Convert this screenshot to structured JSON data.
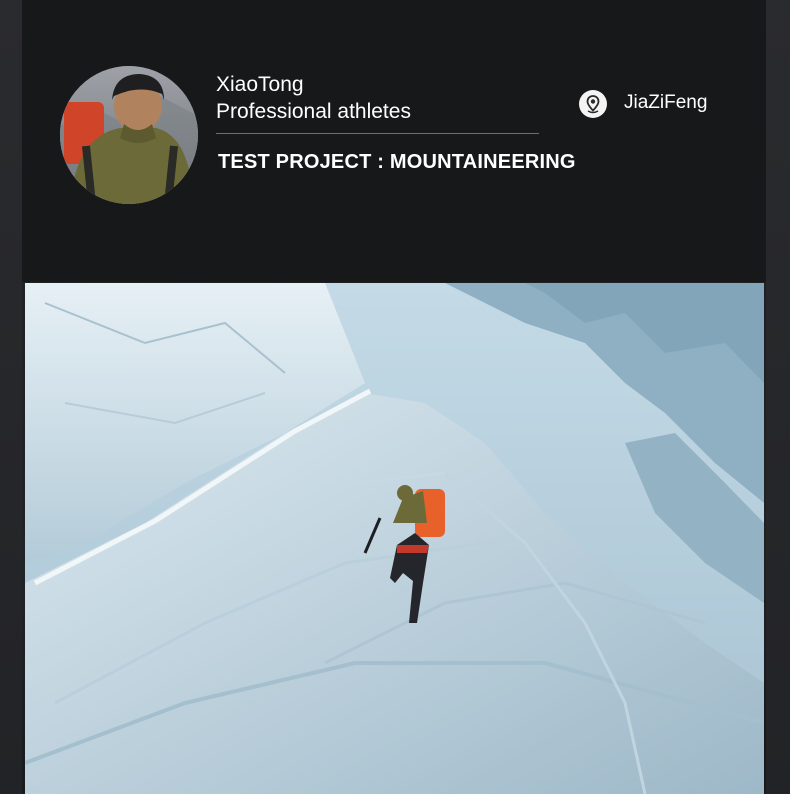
{
  "profile": {
    "name": "XiaoTong",
    "role": "Professional athletes",
    "project": "TEST PROJECT : MOUNTAINEERING",
    "location": "JiaZiFeng"
  },
  "icons": {
    "location": "location-pin-icon"
  },
  "colors": {
    "background": "#1a1b1d",
    "text": "#ffffff",
    "divider": "#6d6e71",
    "backpack_orange": "#e8602a"
  }
}
